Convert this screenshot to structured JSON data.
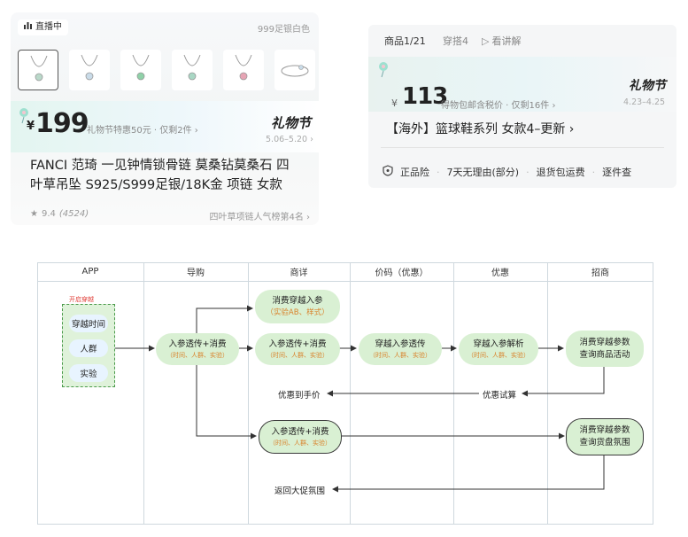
{
  "card1": {
    "live_label": "直播中",
    "variant": "999足银白色",
    "price_symbol": "¥",
    "price": "199",
    "promo": "礼物节特惠50元 · 仅剩2件 ›",
    "festival_logo": "礼物节",
    "dates": "5.06–5.20 ›",
    "title_line1": "FANCI 范琦 一见钟情锁骨链 莫桑钻莫桑石 四",
    "title_line2": "叶草吊坠 S925/S999足银/18K金 项链 女款",
    "rating": "9.4",
    "review_count": "(4524)",
    "rank": "四叶草项链人气榜第4名 ›",
    "thumb_icons": [
      "pendant-necklace-icon",
      "pendant-necklace-icon",
      "pendant-necklace-icon",
      "pendant-necklace-icon",
      "pendant-necklace-icon",
      "bracelet-icon"
    ]
  },
  "card2": {
    "tabs": [
      "商品1/21",
      "穿搭4",
      "看讲解"
    ],
    "price_symbol": "¥",
    "price": "113",
    "promo": "得物包邮含税价 · 仅剩16件 ›",
    "festival_logo": "礼物节",
    "dates": "4.23–4.25",
    "title": "【海外】篮球鞋系列 女款4–更新 ›",
    "badges": [
      "正品险",
      "7天无理由(部分)",
      "退货包运费",
      "逐件查"
    ]
  },
  "flow": {
    "columns": [
      "APP",
      "导购",
      "商详",
      "价码（优惠）",
      "优惠",
      "招商"
    ],
    "app_tag": "开启穿越",
    "app_items": [
      "穿越时间",
      "人群",
      "实验"
    ],
    "sub_params": "（时间、人群、实验）",
    "node_guide": "入参透传+消费",
    "node_detail_top": "消费穿越入参",
    "node_detail_top_sub": "（实验AB、样式）",
    "node_detail_mid": "入参透传+消费",
    "node_price": "穿越入参透传",
    "node_promo": "穿越入参解析",
    "node_merchant_top_1": "消费穿越参数",
    "node_merchant_top_2": "查询商品活动",
    "label_promo_calc": "优惠试算",
    "label_to_price": "优惠到手价",
    "node_bottom": "入参透传+消费",
    "node_merchant_bottom_1": "消费穿越参数",
    "node_merchant_bottom_2": "查询货盘氛围",
    "label_return": "返回大促氛围"
  },
  "colors": {
    "node_fill": "#d9f0d3",
    "node_sub_text": "#d9822b",
    "app_tag": "#e0403a"
  }
}
